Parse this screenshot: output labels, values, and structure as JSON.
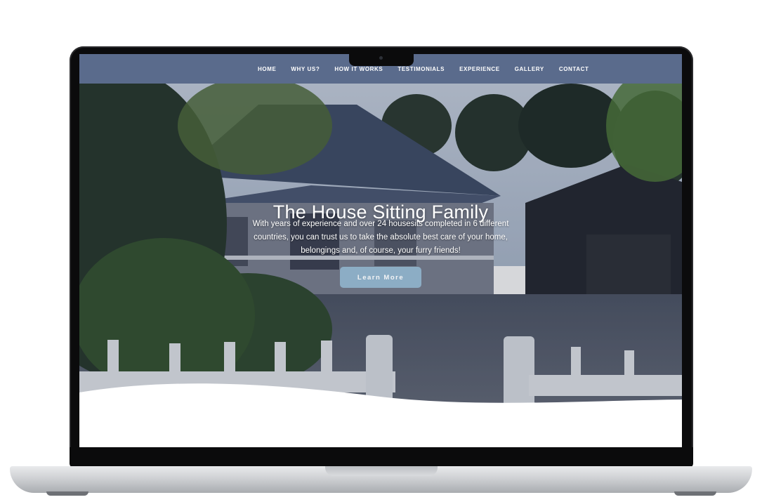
{
  "nav": {
    "items": [
      "HOME",
      "WHY US?",
      "HOW IT WORKS",
      "TESTIMONIALS",
      "EXPERIENCE",
      "GALLERY",
      "CONTACT"
    ]
  },
  "hero": {
    "title": "The House Sitting Family",
    "text": "With years of experience and over 24 housesits completed in 6 different countries, you can trust us to take the absolute best care of your home, belongings and, of course, your furry friends!",
    "cta_label": "Learn More"
  },
  "colors": {
    "nav_bg": "#5a6b8c",
    "cta_bg": "#8fb3cb",
    "page_bg": "#ffffff"
  }
}
